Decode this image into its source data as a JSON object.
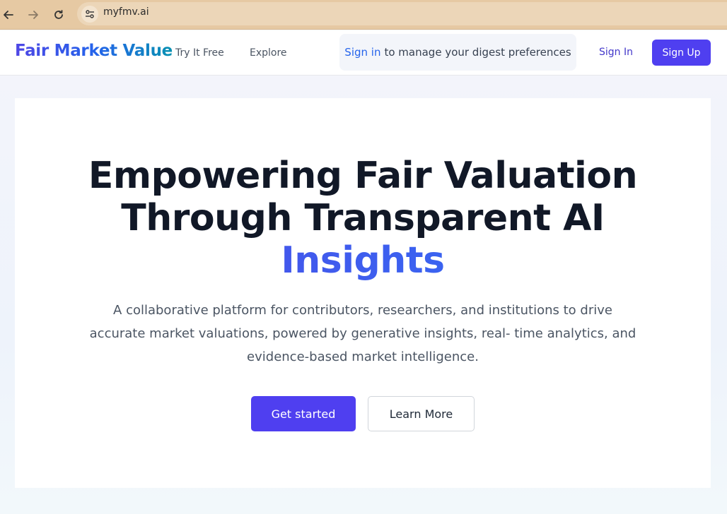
{
  "browser": {
    "url": "myfmv.ai"
  },
  "header": {
    "brand": "Fair Market Value",
    "nav": [
      {
        "label": "Try It Free"
      },
      {
        "label": "Explore"
      }
    ],
    "digest": {
      "link_text": "Sign in",
      "text": "to manage your digest preferences"
    },
    "sign_in": "Sign In",
    "sign_up": "Sign Up"
  },
  "hero": {
    "title_line1": "Empowering Fair Valuation",
    "title_line2": "Through Transparent AI",
    "title_accent": "Insights",
    "subtitle": "A collaborative platform for contributors, researchers, and institutions to drive accurate market valuations, powered by generative insights, real- time analytics, and evidence-based market intelligence.",
    "primary_cta": "Get started",
    "secondary_cta": "Learn More"
  },
  "colors": {
    "brand_primary": "#4f3ff0",
    "link_blue": "#2563eb",
    "browser_chrome": "#e6c9a3"
  }
}
